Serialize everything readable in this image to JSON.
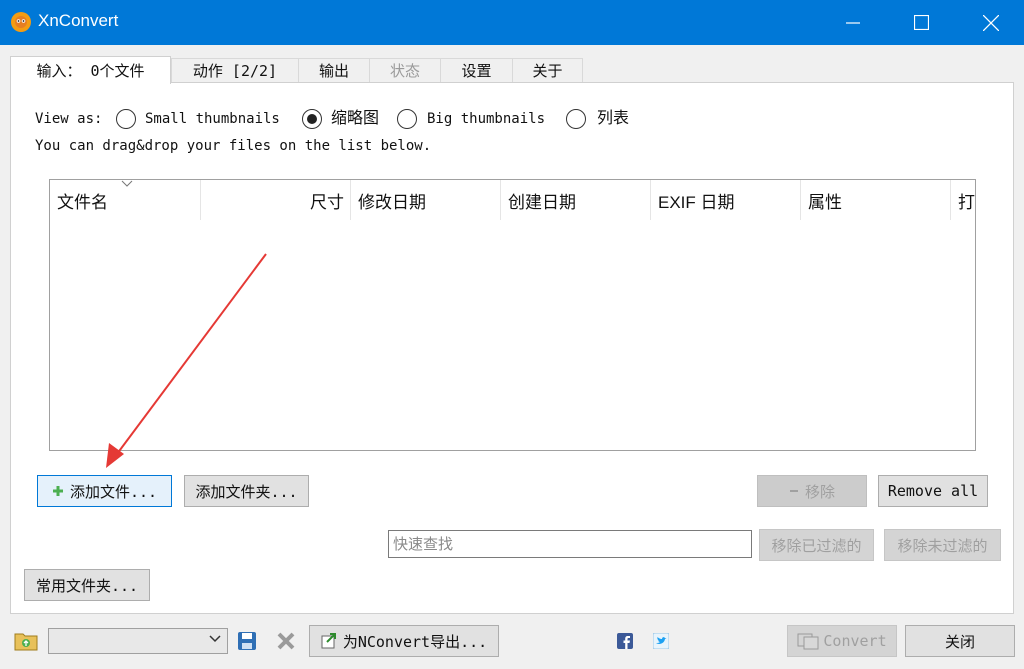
{
  "window": {
    "title": "XnConvert"
  },
  "tabs": [
    {
      "label": "输入： 0个文件",
      "state": "active"
    },
    {
      "label": "动作 [2/2]",
      "state": "normal"
    },
    {
      "label": "输出",
      "state": "normal"
    },
    {
      "label": "状态",
      "state": "disabled"
    },
    {
      "label": "设置",
      "state": "normal"
    },
    {
      "label": "关于",
      "state": "normal"
    }
  ],
  "view_as": {
    "label": "View as:",
    "options": [
      {
        "label": "Small thumbnails",
        "checked": false
      },
      {
        "label": "缩略图",
        "checked": true
      },
      {
        "label": "Big thumbnails",
        "checked": false
      },
      {
        "label": "列表",
        "checked": false
      }
    ]
  },
  "hint": "You can drag&drop your files on the list below.",
  "file_list": {
    "columns": [
      "文件名",
      "尺寸",
      "修改日期",
      "创建日期",
      "EXIF 日期",
      "属性",
      "打"
    ],
    "rows": []
  },
  "buttons": {
    "add_files": "添加文件...",
    "add_folder": "添加文件夹...",
    "remove": "移除",
    "remove_all": "Remove all",
    "remove_filtered": "移除已过滤的",
    "remove_unfiltered": "移除未过滤的",
    "favorite_folders": "常用文件夹...",
    "export_nconvert": "为NConvert导出...",
    "convert": "Convert",
    "close": "关闭"
  },
  "search": {
    "placeholder": "快速查找",
    "value": ""
  },
  "colors": {
    "titlebar": "#0078d7",
    "annotation_arrow": "#e53935"
  },
  "icons": [
    "xnconvert-logo-icon",
    "minimize-icon",
    "maximize-icon",
    "close-icon",
    "sort-desc-icon",
    "plus-icon",
    "minus-icon",
    "folder-icon",
    "chevron-down-icon",
    "save-icon",
    "delete-icon",
    "export-icon",
    "facebook-icon",
    "twitter-icon",
    "convert-icon"
  ]
}
